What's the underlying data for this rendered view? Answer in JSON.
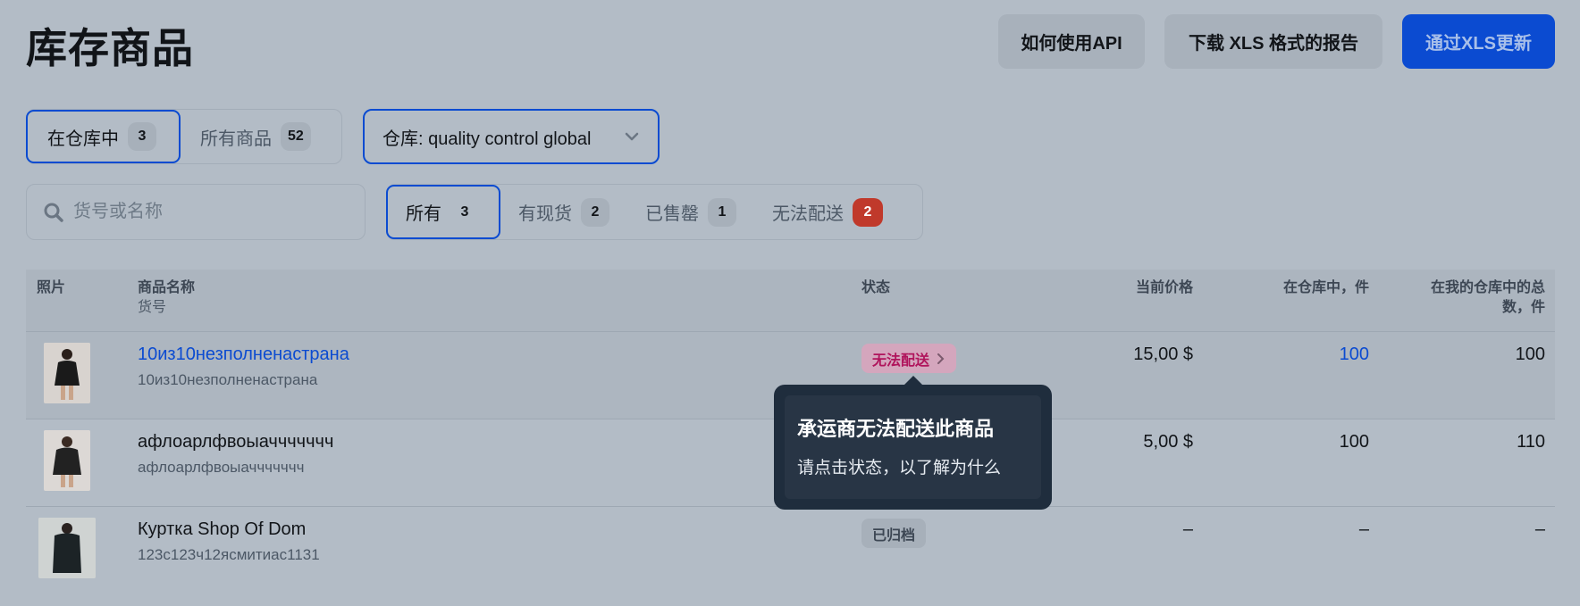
{
  "header": {
    "title": "库存商品",
    "buttons": {
      "api": "如何使用API",
      "download_xls": "下载 XLS 格式的报告",
      "update_xls": "通过XLS更新"
    }
  },
  "stock_tabs": [
    {
      "label": "在仓库中",
      "count": "3",
      "active": true
    },
    {
      "label": "所有商品",
      "count": "52",
      "active": false
    }
  ],
  "warehouse": {
    "label": "仓库: quality control global"
  },
  "search": {
    "placeholder": "货号或名称",
    "value": ""
  },
  "filter_tabs": [
    {
      "label": "所有",
      "count": "3",
      "active": true
    },
    {
      "label": "有现货",
      "count": "2",
      "active": false
    },
    {
      "label": "已售罄",
      "count": "1",
      "active": false
    },
    {
      "label": "无法配送",
      "count": "2",
      "active": false,
      "alert": true
    }
  ],
  "table": {
    "columns": {
      "photo": "照片",
      "name": "商品名称",
      "sku": "货号",
      "status": "状态",
      "price": "当前价格",
      "in_warehouse": "在仓库中，件",
      "total_line1": "在我的仓库中的总",
      "total_line2": "数，件"
    },
    "rows": [
      {
        "name": "10из10незполненастрана",
        "sku": "10из10незполненастрана",
        "status": "无法配送",
        "price": "15,00 $",
        "in_warehouse": "100",
        "total": "100"
      },
      {
        "name": "афлоарлфвоыаччччччч",
        "sku": "афлоарлфвоыаччччччч",
        "status": "",
        "price": "5,00 $",
        "in_warehouse": "100",
        "total": "110"
      },
      {
        "name": "Куртка Shop Of Dom",
        "sku": "123с123ч12ясмитиас1131",
        "status": "已归档",
        "price": "–",
        "in_warehouse": "–",
        "total": "–"
      }
    ]
  },
  "tooltip": {
    "title": "承运商无法配送此商品",
    "body": "请点击状态，以了解为什么"
  },
  "colors": {
    "accent": "#0b4bd1",
    "alert_badge": "#c0392b",
    "status_undeliverable": "#b0145c",
    "tooltip_bg": "#1f2d3d"
  },
  "icons": {
    "search": "search-icon",
    "warehouse_dropdown": "chevron-down-icon",
    "status_arrow": "chevron-right-icon"
  }
}
